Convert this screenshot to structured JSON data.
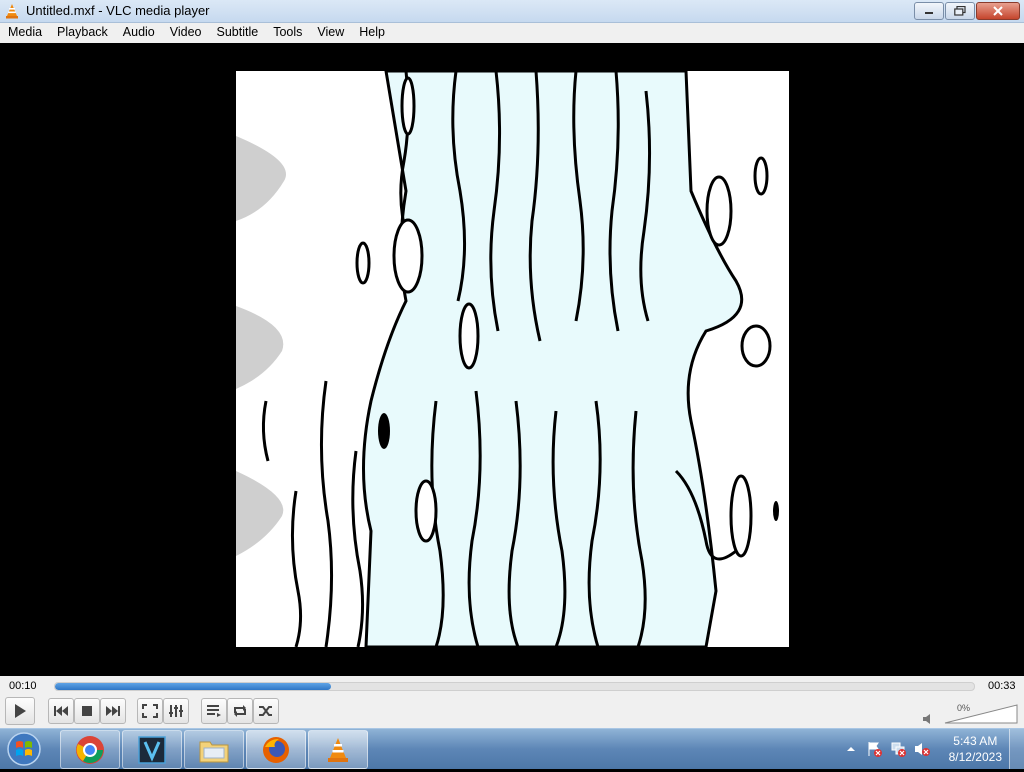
{
  "window": {
    "title": "Untitled.mxf - VLC media player"
  },
  "menu": {
    "items": [
      "Media",
      "Playback",
      "Audio",
      "Video",
      "Subtitle",
      "Tools",
      "View",
      "Help"
    ]
  },
  "playback": {
    "elapsed": "00:10",
    "total": "00:33",
    "progress_fraction": 0.3,
    "volume_label": "0%"
  },
  "taskbar": {
    "apps": [
      "chrome-icon",
      "v-app-icon",
      "file-explorer-icon",
      "firefox-icon",
      "vlc-icon"
    ],
    "time": "5:43 AM",
    "date": "8/12/2023"
  },
  "colors": {
    "seek_fill": "#2f77c6",
    "video_tint": "#e8fafc",
    "background": "#000000"
  }
}
